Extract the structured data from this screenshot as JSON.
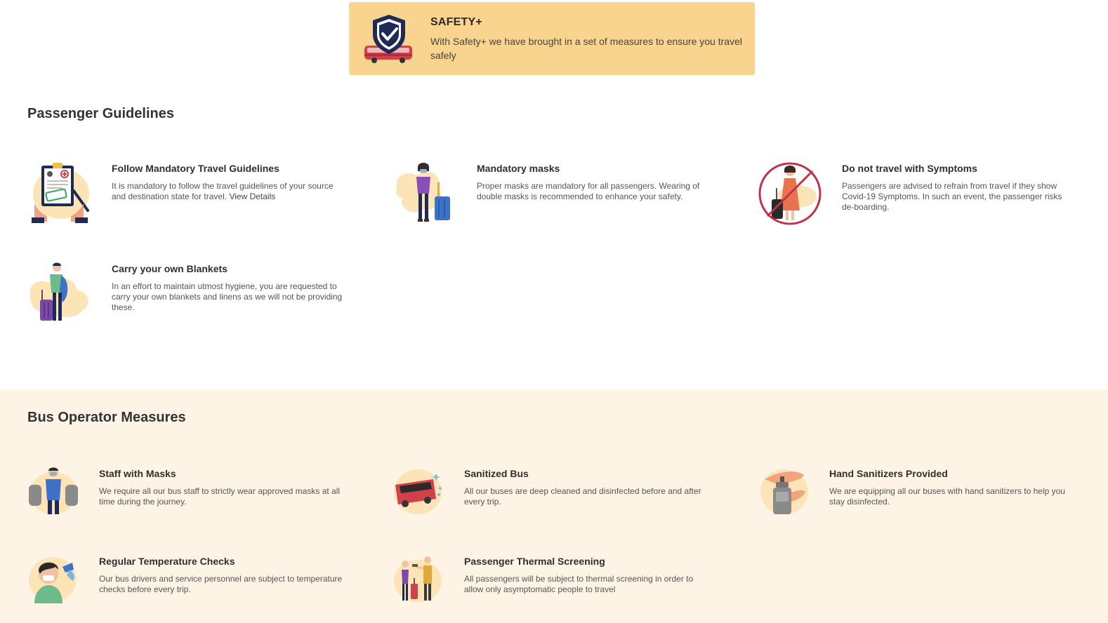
{
  "banner": {
    "title": "SAFETY+",
    "description": "With Safety+ we have brought in a set of measures to ensure you travel safely"
  },
  "passenger_guidelines": {
    "heading": "Passenger Guidelines",
    "items": [
      {
        "title": "Follow Mandatory Travel Guidelines",
        "description": "It is mandatory to follow the travel guidelines of your source and destination state for travel.",
        "link": "View Details",
        "icon": "clipboard-access-granted-icon"
      },
      {
        "title": "Mandatory masks",
        "description": "Proper masks are mandatory for all passengers. Wearing of double masks is recommended to enhance your safety.",
        "icon": "masked-passenger-icon"
      },
      {
        "title": "Do not travel with Symptoms",
        "description": "Passengers are advised to refrain from travel if they show Covid-19 Symptoms. In such an event, the passenger risks de-boarding.",
        "icon": "no-symptoms-icon"
      },
      {
        "title": "Carry your own Blankets",
        "description": "In an effort to maintain utmost hygiene, you are requested to carry your own blankets and linens as we will not be providing these.",
        "icon": "blanket-traveller-icon"
      }
    ]
  },
  "operator_measures": {
    "heading": "Bus Operator Measures",
    "items": [
      {
        "title": "Staff with Masks",
        "description": "We require all our bus staff to strictly wear approved masks at all time during the journey.",
        "icon": "staff-mask-icon"
      },
      {
        "title": "Sanitized Bus",
        "description": "All our buses are deep cleaned and disinfected before and after every trip.",
        "icon": "sanitized-bus-icon"
      },
      {
        "title": "Hand Sanitizers Provided",
        "description": "We are equipping all our buses with hand sanitizers to help you stay disinfected.",
        "icon": "hand-sanitizer-icon"
      },
      {
        "title": "Regular Temperature Checks",
        "description": "Our bus drivers and service personnel are subject to temperature checks before every trip.",
        "icon": "temperature-check-icon"
      },
      {
        "title": "Passenger Thermal Screening",
        "description": "All passengers will be subject to thermal screening in order to allow only asymptomatic people to travel",
        "icon": "thermal-screening-icon"
      }
    ]
  },
  "colors": {
    "banner_bg": "#f9d48f",
    "section_bg": "#fef4e5",
    "blob": "#fde4b6",
    "shield": "#1f2a57",
    "bus_red": "#d2404a"
  }
}
